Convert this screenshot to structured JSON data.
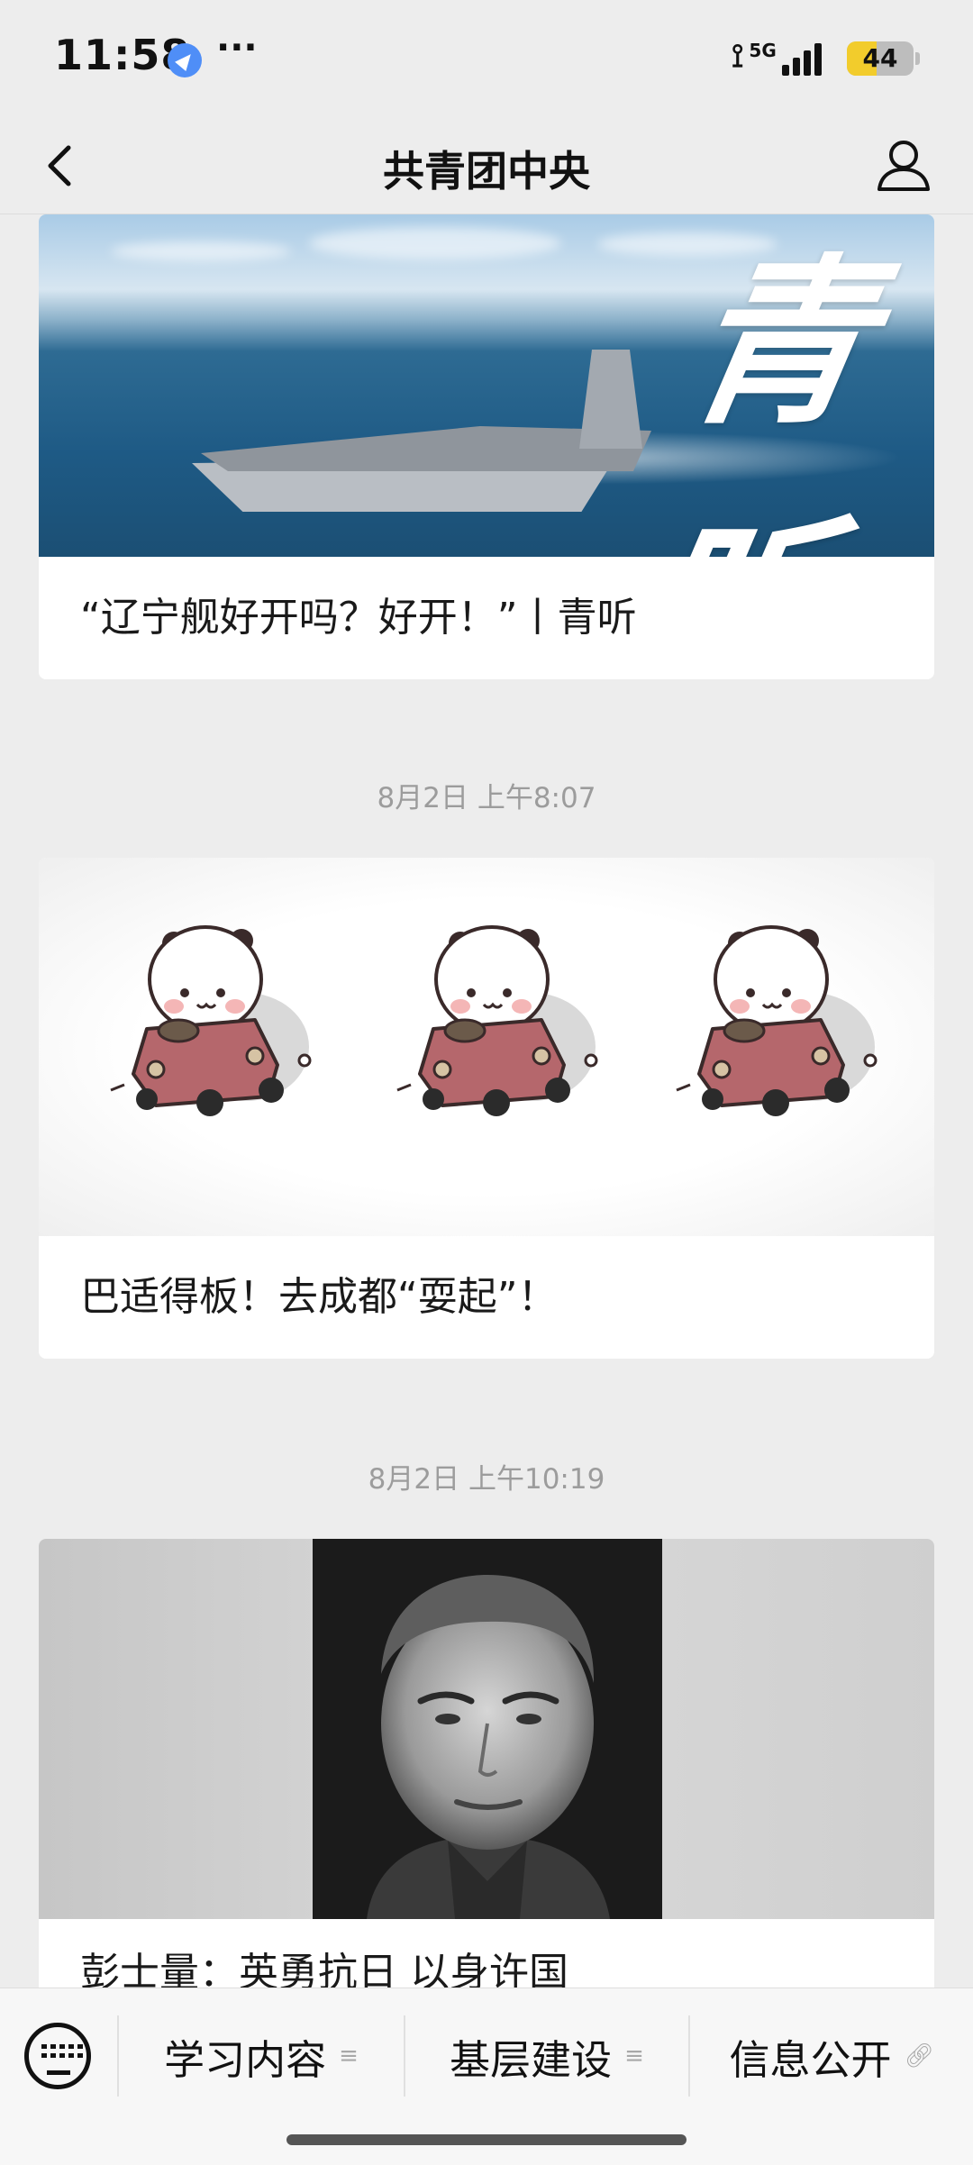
{
  "status_bar": {
    "time": "11:58",
    "more": "···",
    "network": "5G",
    "battery_percent": 44,
    "battery_label": "44"
  },
  "nav": {
    "title": "共青团中央",
    "back_icon": "chevron-left-icon",
    "profile_icon": "person-icon"
  },
  "feed": [
    {
      "title": "“辽宁舰好开吗？好开！”丨青听",
      "image_text": "青听",
      "image_icon": "aircraft-carrier-image"
    },
    {
      "timestamp": "8月2日 上午8:07",
      "title": "巴适得板！去成都“耍起”！",
      "image_icon": "panda-driving-car-illustration"
    },
    {
      "timestamp": "8月2日 上午10:19",
      "title": "彭士量：英勇抗日 以身许国",
      "image_icon": "historical-portrait-photo"
    }
  ],
  "bottom_menu": {
    "keyboard_icon": "keyboard-icon",
    "items": [
      {
        "label": "学习内容",
        "icon": "list-icon"
      },
      {
        "label": "基层建设",
        "icon": "list-icon"
      },
      {
        "label": "信息公开",
        "icon": "link-icon"
      }
    ]
  },
  "colors": {
    "background": "#ededed",
    "card": "#ffffff",
    "timestamp": "#9c9c9c",
    "battery": "#f2cc2c"
  }
}
